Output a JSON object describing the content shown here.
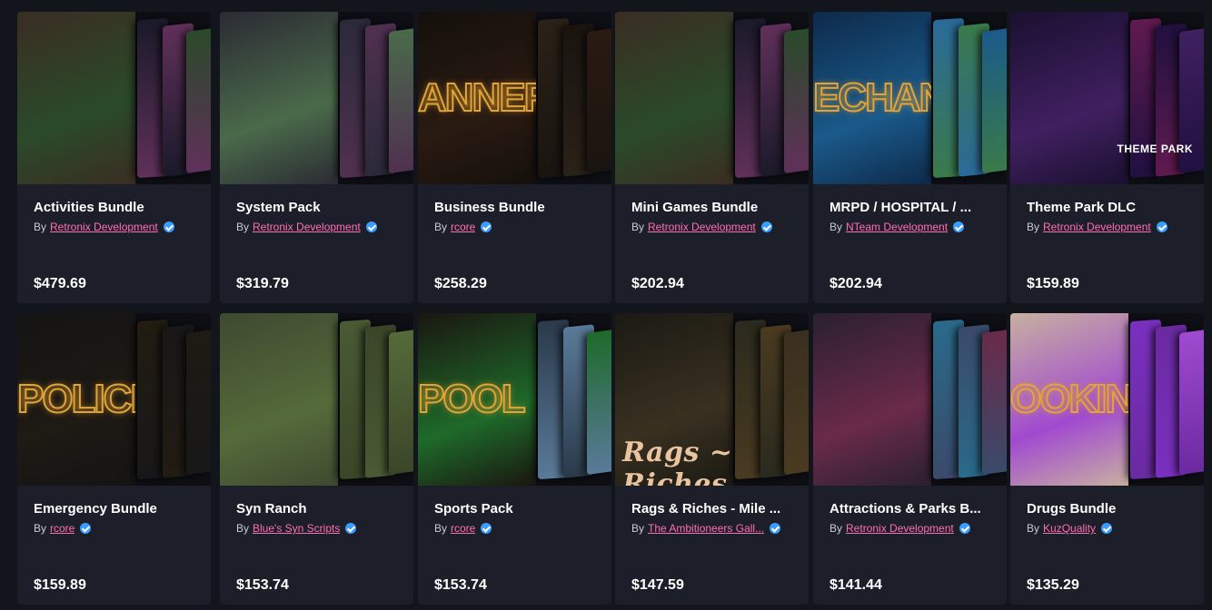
{
  "by_prefix": "By",
  "cards": [
    {
      "title": "Activities Bundle",
      "author": "Retronix Development",
      "price": "$479.69",
      "thumb_text": "",
      "overlay": "",
      "colors": [
        "#3a2d22",
        "#2a4a2a",
        "#1a1a2a",
        "#60305a"
      ]
    },
    {
      "title": "System Pack",
      "author": "Retronix Development",
      "price": "$319.79",
      "thumb_text": "",
      "overlay": "",
      "colors": [
        "#2b2b33",
        "#4a6a4a",
        "#2a2a3a",
        "#503050"
      ]
    },
    {
      "title": "Business Bundle",
      "author": "rcore",
      "price": "$258.29",
      "thumb_text": "ANNER",
      "overlay": "",
      "colors": [
        "#14100c",
        "#2a1a12",
        "#2a2218",
        "#1a1410"
      ]
    },
    {
      "title": "Mini Games Bundle",
      "author": "Retronix Development",
      "price": "$202.94",
      "thumb_text": "",
      "overlay": "",
      "colors": [
        "#3a2d22",
        "#2a4a2a",
        "#1a1a2a",
        "#60305a"
      ]
    },
    {
      "title": "MRPD / HOSPITAL / ...",
      "author": "NTeam Development",
      "price": "$202.94",
      "thumb_text": "ECHAN",
      "overlay": "",
      "colors": [
        "#0d2a4a",
        "#1a5a8a",
        "#2a6a9a",
        "#3a7a4a"
      ]
    },
    {
      "title": "Theme Park DLC",
      "author": "Retronix Development",
      "price": "$159.89",
      "thumb_text": "",
      "overlay": "THEME PARK",
      "colors": [
        "#1a1030",
        "#402060",
        "#601a50",
        "#201040"
      ]
    },
    {
      "title": "Emergency Bundle",
      "author": "rcore",
      "price": "$159.89",
      "thumb_text": "POLICE",
      "overlay": "",
      "colors": [
        "#141414",
        "#1e1a14",
        "#221c12",
        "#181818"
      ]
    },
    {
      "title": "Syn Ranch",
      "author": "Blue's Syn Scripts",
      "price": "$153.74",
      "thumb_text": "",
      "overlay": "",
      "colors": [
        "#3e4a30",
        "#556a3a",
        "#4a5a34",
        "#3a4628"
      ]
    },
    {
      "title": "Sports Pack",
      "author": "rcore",
      "price": "$153.74",
      "thumb_text": "POOL",
      "overlay": "",
      "colors": [
        "#1a1610",
        "#1e6a2a",
        "#2a3a4a",
        "#5a7a9a"
      ]
    },
    {
      "title": "Rags & Riches - Mile ...",
      "author": "The Ambitioneers Gall...",
      "price": "$147.59",
      "thumb_text": "",
      "overlay": "Rags ~ Riches",
      "colors": [
        "#1a1a14",
        "#3a3020",
        "#2a2a1e",
        "#4a3a20"
      ]
    },
    {
      "title": "Attractions & Parks B...",
      "author": "Retronix Development",
      "price": "$141.44",
      "thumb_text": "",
      "overlay": "",
      "colors": [
        "#2a2030",
        "#6a2a4a",
        "#2a6a8a",
        "#3a4a6a"
      ]
    },
    {
      "title": "Drugs Bundle",
      "author": "KuzQuality",
      "price": "$135.29",
      "thumb_text": "OOKING",
      "overlay": "",
      "colors": [
        "#c8b0a0",
        "#a04ad0",
        "#7a30c0",
        "#6a2aa0"
      ]
    }
  ]
}
